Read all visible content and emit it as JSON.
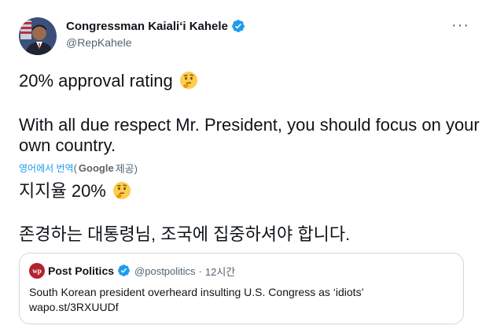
{
  "author": {
    "name": "Congressman Kaialiʻi Kahele",
    "handle": "@RepKahele",
    "verified": true
  },
  "more_label": "···",
  "tweet": {
    "line1": "20% approval rating",
    "line2": "With all due respect Mr. President, you should focus on your own country.",
    "emoji": "thinking-face"
  },
  "translation": {
    "label": "영어에서 번역",
    "open": "(",
    "provider": "Google",
    "suffix": "제공)",
    "line1": "지지율 20%",
    "line2": "존경하는 대통령님, 조국에 집중하셔야 합니다."
  },
  "quote": {
    "logo_text": "wp",
    "name": "Post Politics",
    "handle": "@postpolitics",
    "dot": "·",
    "time": "12시간",
    "text_line1": "South Korean president overheard insulting U.S. Congress as ‘idiots’",
    "text_line2": "wapo.st/3RXUUDf"
  },
  "colors": {
    "verified": "#1d9bf0",
    "link": "#1d9bf0",
    "secondary": "#536471",
    "border": "#cfd9de",
    "wp_logo": "#b3222f"
  }
}
